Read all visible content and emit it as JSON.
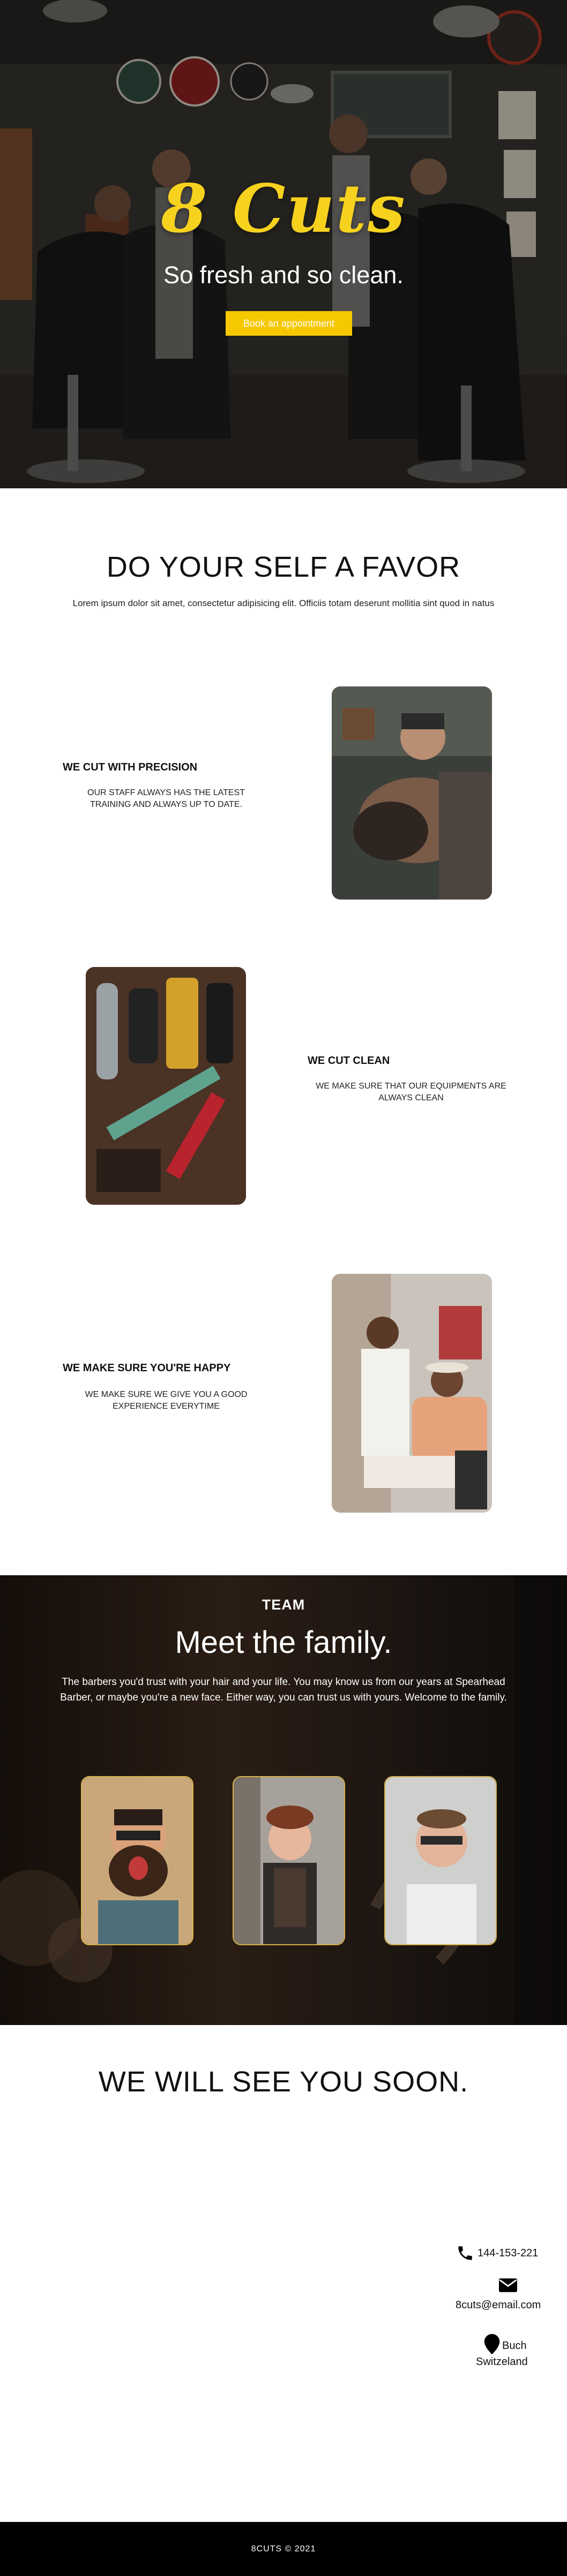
{
  "hero": {
    "brand": "8 Cuts",
    "tagline": "So fresh and so clean.",
    "cta_label": "Book an appointment"
  },
  "favor": {
    "title": "DO YOUR SELF A FAVOR",
    "text": "Lorem ipsum dolor sit amet, consectetur adipisicing elit. Officiis totam deserunt mollitia sint quod in natus"
  },
  "features": [
    {
      "title": "WE CUT WITH PRECISION",
      "text": "OUR STAFF ALWAYS HAS THE LATEST TRAINING AND ALWAYS UP TO DATE."
    },
    {
      "title": "WE CUT CLEAN",
      "text": "WE MAKE SURE THAT OUR EQUIPMENTS ARE ALWAYS CLEAN"
    },
    {
      "title": "WE MAKE SURE YOU'RE HAPPY",
      "text": "WE MAKE SURE WE GIVE YOU A GOOD EXPERIENCE EVERYTIME"
    }
  ],
  "team": {
    "label": "TEAM",
    "title": "Meet the family.",
    "text": "The barbers you'd trust with your hair and your life. You may know us from our years at Spearhead Barber, or maybe you're a new face. Either way, you can trust us with yours. Welcome to the family."
  },
  "contact": {
    "title": "WE WILL SEE YOU SOON.",
    "phone": "144-153-221",
    "email": "8cuts@email.com",
    "city": "Buch",
    "country": "Switzeland"
  },
  "footer": {
    "text": "8CUTS © 2021"
  },
  "colors": {
    "accent": "#f6c800",
    "brand_yellow": "#f6d21f",
    "footer_bg": "#000000"
  },
  "icons": [
    "phone-icon",
    "envelope-icon",
    "location-pin-icon"
  ]
}
